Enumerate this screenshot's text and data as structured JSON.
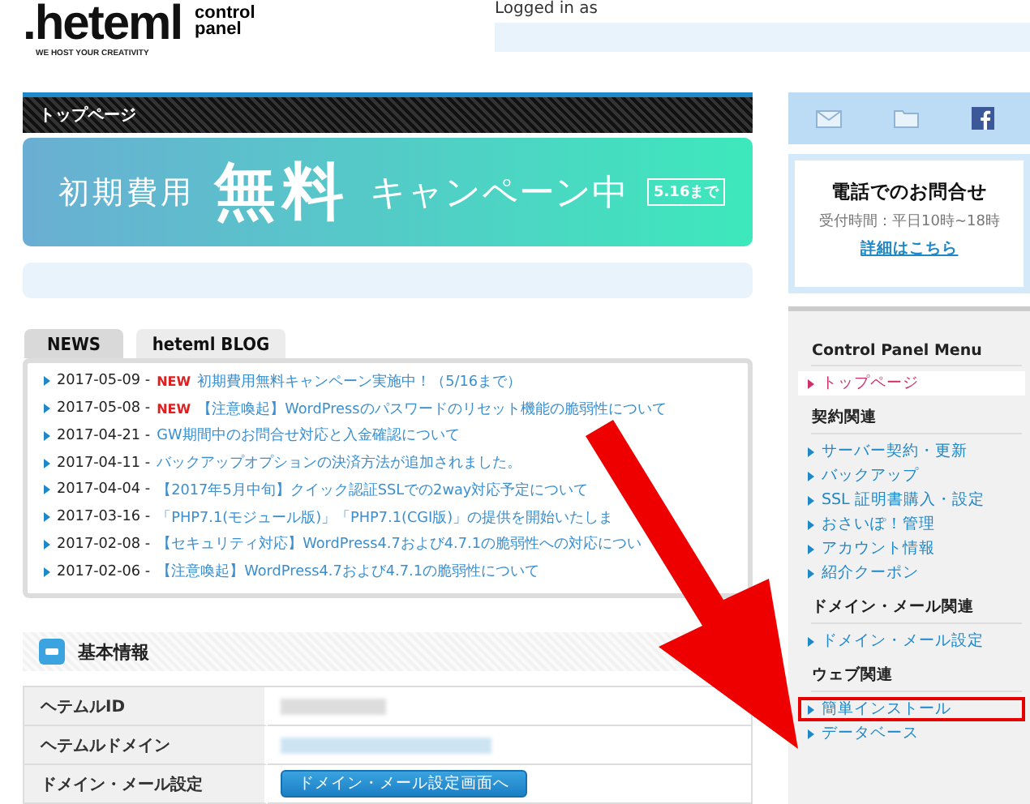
{
  "header": {
    "logo": ".heteml",
    "logo_sub": "control panel",
    "tagline": "WE HOST YOUR CREATIVITY",
    "login": "Logged in as"
  },
  "page_title": "トップページ",
  "banner": {
    "lead": "初期費用",
    "main": "無料",
    "tail": "キャンペーン中",
    "badge": "5.16まで"
  },
  "news_tabs": [
    {
      "label": "NEWS",
      "selected": true
    },
    {
      "label": "heteml BLOG",
      "selected": false
    }
  ],
  "news": [
    {
      "date": "2017-05-09 -",
      "badge": "NEW",
      "title": "初期費用無料キャンペーン実施中！（5/16まで）"
    },
    {
      "date": "2017-05-08 -",
      "badge": "NEW",
      "title": "【注意喚起】WordPressのパスワードのリセット機能の脆弱性について"
    },
    {
      "date": "2017-04-21 -",
      "title": "GW期間中のお問合せ対応と入金確認について"
    },
    {
      "date": "2017-04-11 -",
      "title": "バックアップオプションの決済方法が追加されました。"
    },
    {
      "date": "2017-04-04 -",
      "title": "【2017年5月中旬】クイック認証SSLでの2way対応予定について"
    },
    {
      "date": "2017-03-16 -",
      "title": "「PHP7.1(モジュール版)」「PHP7.1(CGI版)」の提供を開始いたしま"
    },
    {
      "date": "2017-02-08 -",
      "title": "【セキュリティ対応】WordPress4.7および4.7.1の脆弱性への対応につい"
    },
    {
      "date": "2017-02-06 -",
      "title": "【注意喚起】WordPress4.7および4.7.1の脆弱性について"
    }
  ],
  "basic_info": {
    "title": "基本情報",
    "rows": [
      {
        "label": "ヘテムルID",
        "kind": "blurred"
      },
      {
        "label": "ヘテムルドメイン",
        "kind": "blurred-link"
      },
      {
        "label": "ドメイン・メール設定",
        "kind": "button",
        "button": "ドメイン・メール設定画面へ"
      }
    ]
  },
  "contact": {
    "title": "電話でのお問合せ",
    "hours": "受付時間：平日10時~18時",
    "link": "詳細はこちら"
  },
  "menu": [
    {
      "heading": "Control Panel Menu",
      "items": [
        {
          "label": "トップページ",
          "selected": true,
          "highlighted": false
        }
      ]
    },
    {
      "heading": "契約関連",
      "items": [
        {
          "label": "サーバー契約・更新",
          "selected": false,
          "highlighted": false
        },
        {
          "label": "バックアップ",
          "selected": false,
          "highlighted": false
        },
        {
          "label": "SSL 証明書購入・設定",
          "selected": false,
          "highlighted": false
        },
        {
          "label": "おさいぽ！管理",
          "selected": false,
          "highlighted": false
        },
        {
          "label": "アカウント情報",
          "selected": false,
          "highlighted": false
        },
        {
          "label": "紹介クーポン",
          "selected": false,
          "highlighted": false
        }
      ]
    },
    {
      "heading": "ドメイン・メール関連",
      "items": [
        {
          "label": "ドメイン・メール設定",
          "selected": false,
          "highlighted": false
        }
      ]
    },
    {
      "heading": "ウェブ関連",
      "items": [
        {
          "label": "簡単インストール",
          "selected": false,
          "highlighted": true
        },
        {
          "label": "データベース",
          "selected": false,
          "highlighted": false
        }
      ]
    }
  ]
}
